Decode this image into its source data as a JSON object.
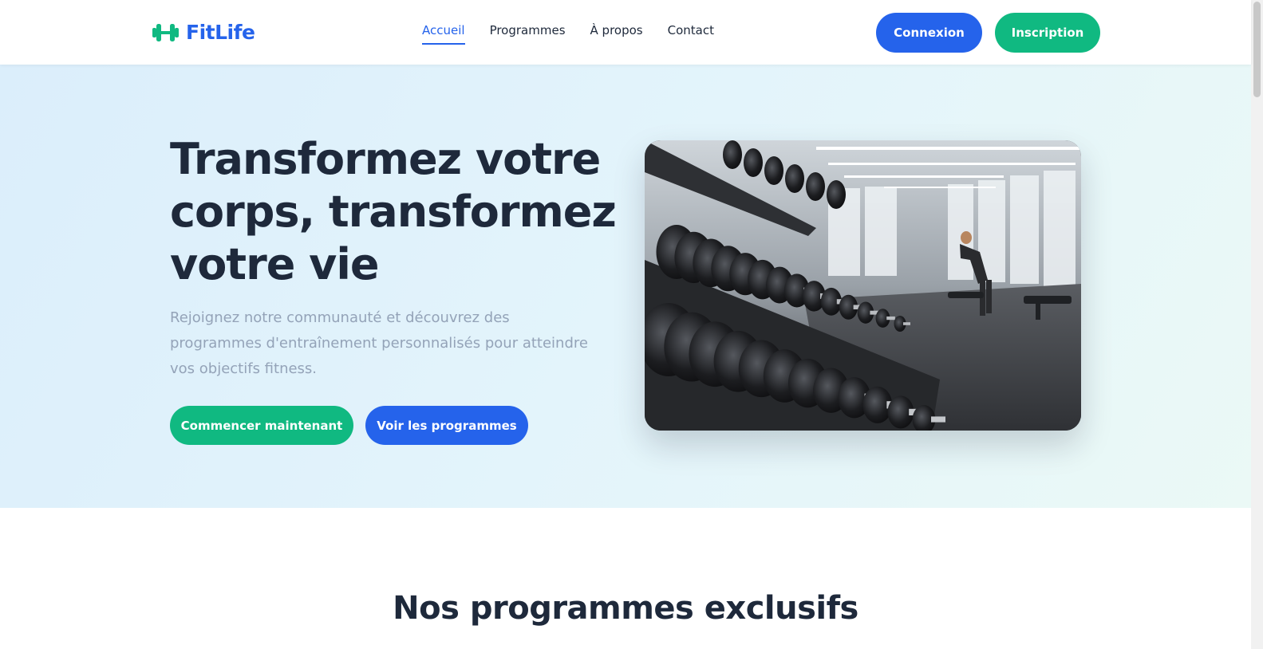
{
  "brand": {
    "name": "FitLife",
    "icon": "dumbbell-icon",
    "accent": "#2563eb",
    "icon_color": "#10b981"
  },
  "nav": {
    "items": [
      {
        "label": "Accueil",
        "active": true
      },
      {
        "label": "Programmes",
        "active": false
      },
      {
        "label": "À propos",
        "active": false
      },
      {
        "label": "Contact",
        "active": false
      }
    ]
  },
  "auth": {
    "login_label": "Connexion",
    "signup_label": "Inscription"
  },
  "hero": {
    "title": "Transformez votre corps, transformez votre vie",
    "subtitle": "Rejoignez notre communauté et découvrez des programmes d'entraînement personnalisés pour atteindre vos objectifs fitness.",
    "primary_cta": "Commencer maintenant",
    "secondary_cta": "Voir les programmes"
  },
  "programs_section": {
    "title": "Nos programmes exclusifs"
  },
  "colors": {
    "primary": "#2563eb",
    "secondary": "#10b981",
    "heading": "#1e293b",
    "muted": "#94a3b8"
  }
}
